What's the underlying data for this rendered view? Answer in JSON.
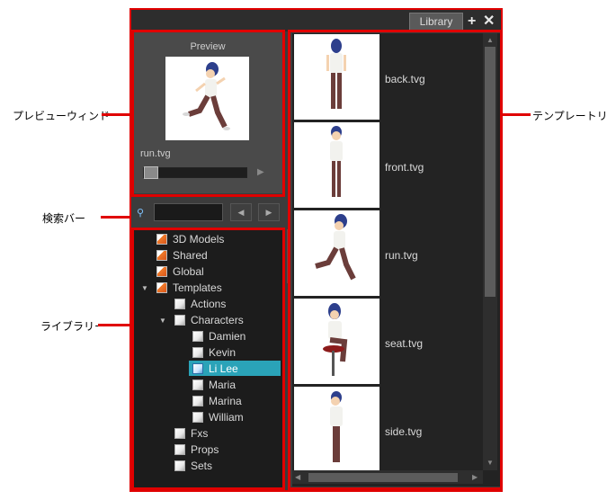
{
  "panel": {
    "tab_label": "Library",
    "add_icon": "plus-icon",
    "close_icon": "close-icon"
  },
  "preview": {
    "title": "Preview",
    "filename": "run.tvg",
    "progress": 0
  },
  "search": {
    "value": "",
    "prev_icon": "left-arrow-icon",
    "next_icon": "right-arrow-icon"
  },
  "tree": {
    "items": [
      {
        "label": "3D Models",
        "icon": "folder-orange"
      },
      {
        "label": "Shared",
        "icon": "folder-orange"
      },
      {
        "label": "Global",
        "icon": "folder-orange"
      },
      {
        "label": "Templates",
        "icon": "folder-orange",
        "expanded": true
      },
      {
        "label": "Actions",
        "icon": "folder-white"
      },
      {
        "label": "Characters",
        "icon": "folder-white",
        "expanded": true
      },
      {
        "label": "Damien",
        "icon": "folder-white"
      },
      {
        "label": "Kevin",
        "icon": "folder-white"
      },
      {
        "label": "Li Lee",
        "icon": "folder-blue",
        "selected": true
      },
      {
        "label": "Maria",
        "icon": "folder-white"
      },
      {
        "label": "Marina",
        "icon": "folder-white"
      },
      {
        "label": "William",
        "icon": "folder-white"
      },
      {
        "label": "Fxs",
        "icon": "folder-white"
      },
      {
        "label": "Props",
        "icon": "folder-white"
      },
      {
        "label": "Sets",
        "icon": "folder-white"
      }
    ]
  },
  "templates": [
    {
      "label": "back.tvg"
    },
    {
      "label": "front.tvg"
    },
    {
      "label": "run.tvg"
    },
    {
      "label": "seat.tvg"
    },
    {
      "label": "side.tvg"
    }
  ],
  "callouts": {
    "preview": "プレビューウィンド",
    "search": "検索バー",
    "library": "ライブラリー",
    "templates": "テンプレートリ"
  },
  "colors": {
    "highlight": "#e00000",
    "selection": "#2aa3b8"
  }
}
